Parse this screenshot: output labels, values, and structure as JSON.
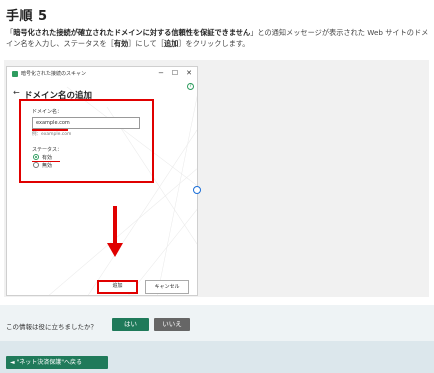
{
  "step": {
    "title": "手順 5",
    "desc_open": "「",
    "desc_bold": "暗号化された接続が確立されたドメインに対する信頼性を保証できません",
    "desc_rest": "」との通知メッセージが表示された Web サイトのドメイン名を入力し、ステータスを［",
    "desc_bold2": "有効",
    "desc_mid": "］にして［",
    "desc_bold3": "追加",
    "desc_end": "］をクリックします。"
  },
  "dialog": {
    "window_title": "暗号化された接続のスキャン",
    "minimize": "−",
    "maximize": "☐",
    "close": "✕",
    "help": "?",
    "back": "←",
    "heading": "ドメイン名の追加",
    "domain_label": "ドメイン名：",
    "domain_value": "example.com",
    "example_text": "例：example.com",
    "status_label": "ステータス：",
    "status_options": [
      "有効",
      "無効"
    ],
    "status_selected": "有効",
    "add_button": "追加",
    "cancel_button": "キャンセル"
  },
  "feedback": {
    "question": "この情報は役に立ちましたか？",
    "yes": "はい",
    "no": "いいえ"
  },
  "footer": {
    "back_link": "◄ \"ネット決済保護\"へ戻る"
  },
  "colors": {
    "accent_green": "#1f7a5a",
    "highlight_red": "#e00000"
  }
}
